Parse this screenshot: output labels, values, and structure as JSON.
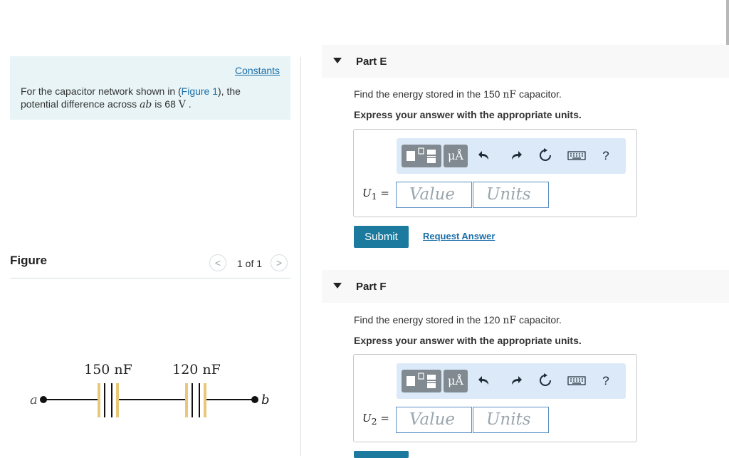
{
  "problem": {
    "constants_link": "Constants",
    "text_before": "For the capacitor network shown in (",
    "figure_link": "Figure 1",
    "text_middle": "), the potential difference across ",
    "ab": "ab",
    "text_is": " is 68 ",
    "volt_unit": "V",
    "text_end": " ."
  },
  "figure": {
    "label": "Figure",
    "counter": "1 of 1",
    "prev_icon": "<",
    "next_icon": ">",
    "circuit": {
      "node_a": "a",
      "node_b": "b",
      "cap1_label": "150 nF",
      "cap2_label": "120 nF"
    }
  },
  "toolbar": {
    "units_label": "μÅ",
    "undo_icon": "undo-arrow",
    "redo_icon": "redo-arrow",
    "reset_icon": "reset-circle-arrow",
    "keyboard_icon": "keyboard",
    "help_label": "?"
  },
  "parts": [
    {
      "title": "Part E",
      "question_before": "Find the energy stored in the 150 ",
      "question_unit": "nF",
      "question_after": " capacitor.",
      "instruction": "Express your answer with the appropriate units.",
      "answer_var": "U",
      "answer_sub": "1",
      "answer_eq": " =",
      "value_placeholder": "Value",
      "units_placeholder": "Units",
      "submit_label": "Submit",
      "request_label": "Request Answer"
    },
    {
      "title": "Part F",
      "question_before": "Find the energy stored in the 120 ",
      "question_unit": "nF",
      "question_after": " capacitor.",
      "instruction": "Express your answer with the appropriate units.",
      "answer_var": "U",
      "answer_sub": "2",
      "answer_eq": " =",
      "value_placeholder": "Value",
      "units_placeholder": "Units"
    }
  ],
  "colors": {
    "accent": "#1b7a9d",
    "link": "#1a6ea8",
    "problem_bg": "#e8f4f6",
    "toolbar_bg": "#dbe9f8",
    "capacitor_plate": "#e8c878"
  }
}
